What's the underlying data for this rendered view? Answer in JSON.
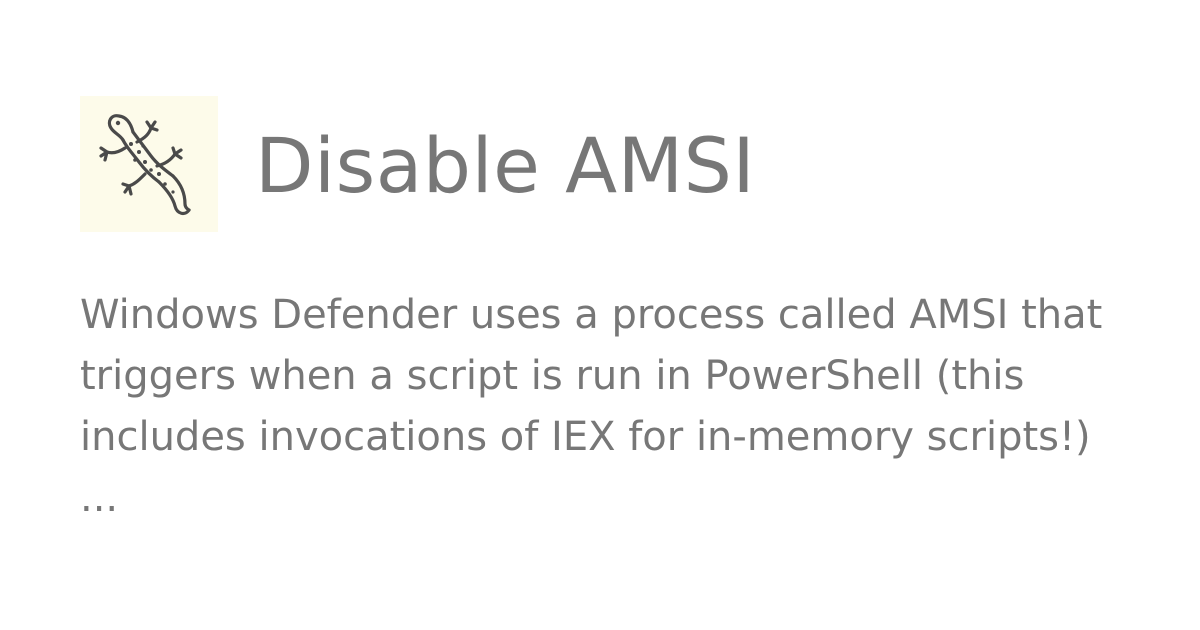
{
  "card": {
    "title": "Disable AMSI",
    "description": "Windows Defender uses a process called AMSI that triggers when a script is run in PowerShell (this includes invocations of IEX for in-memory scripts!) ...",
    "logo_icon": "gecko-icon"
  },
  "colors": {
    "text": "#777777",
    "logo_background": "#fdfbea",
    "logo_stroke": "#4a4a4a"
  }
}
